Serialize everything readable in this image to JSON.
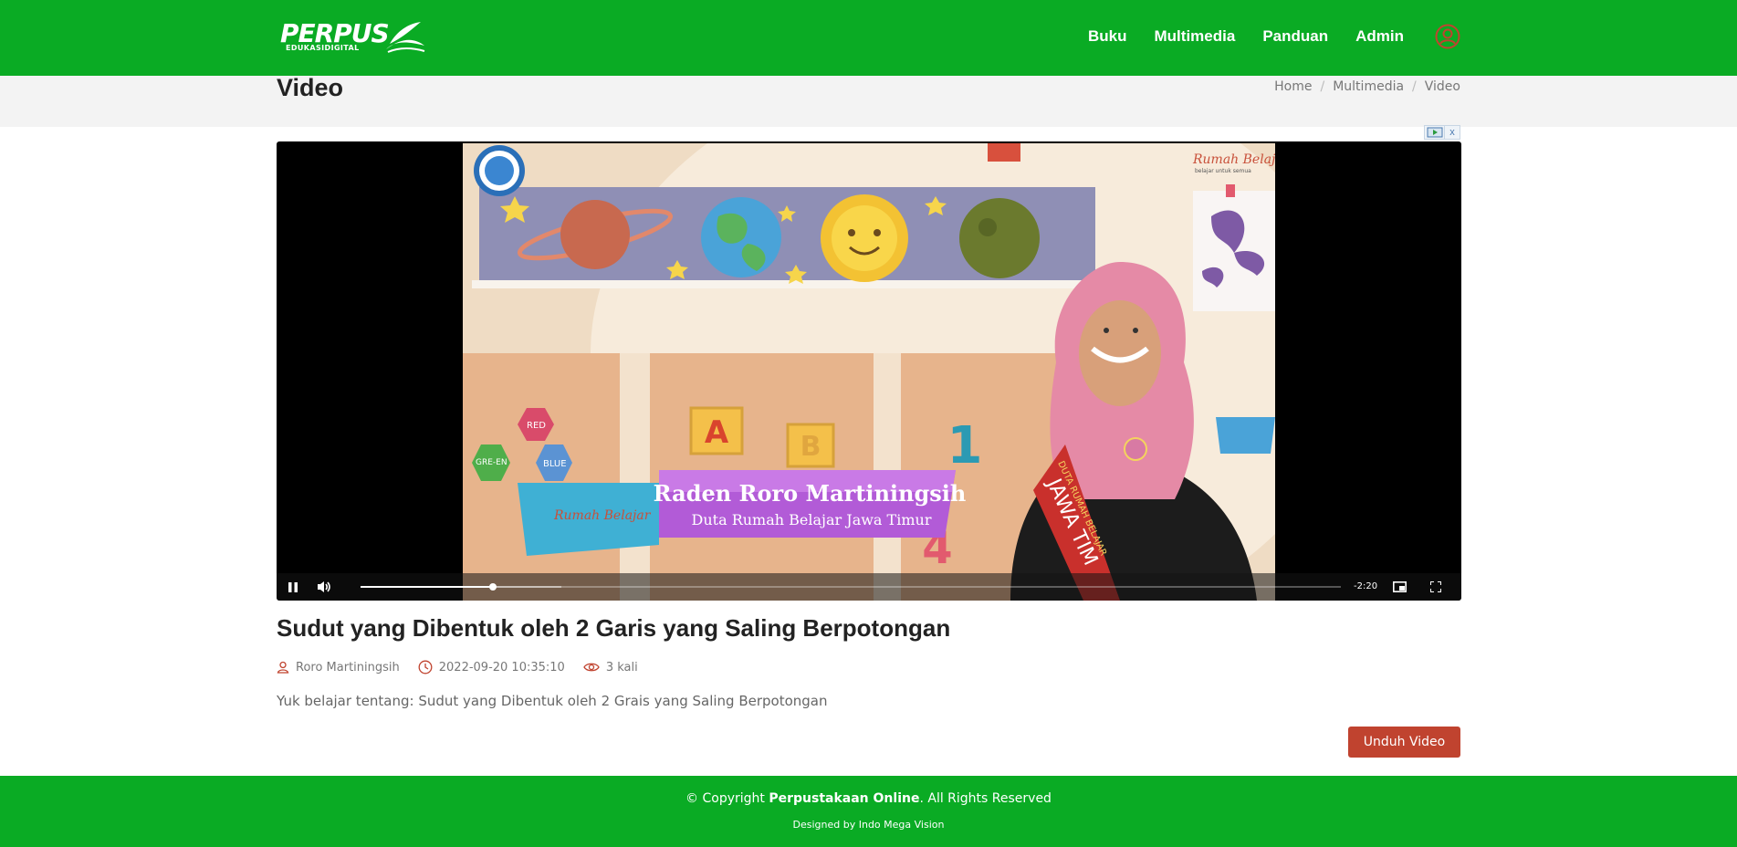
{
  "header": {
    "logo_text": "PERPUS",
    "logo_subtext": "EDUKASIDIGITAL",
    "nav": [
      "Buku",
      "Multimedia",
      "Panduan",
      "Admin"
    ],
    "user_icon": "user-circle-icon"
  },
  "titlebar": {
    "title": "Video",
    "breadcrumb": [
      "Home",
      "Multimedia",
      "Video"
    ]
  },
  "player": {
    "overlay_name": "Raden Roro Martiningsih",
    "overlay_role": "Duta Rumah Belajar Jawa Timur",
    "brand": "Rumah Belajar",
    "brand_tagline": "belajar untuk semua",
    "sash_text": "DUTA RUMAH BELAJAR",
    "sash_big": "JAWA TIM",
    "shape_labels": [
      "RED",
      "GRE-EN",
      "BLUE"
    ],
    "letters": [
      "A",
      "B",
      "1",
      "4"
    ],
    "time_remaining": "-2:20",
    "progress_played": 0.135,
    "progress_buffered": 0.205,
    "state": "playing"
  },
  "video": {
    "title": "Sudut yang Dibentuk oleh 2 Garis yang Saling Berpotongan",
    "author": "Roro Martiningsih",
    "datetime": "2022-09-20 10:35:10",
    "views": "3 kali",
    "description": "Yuk belajar tentang: Sudut yang Dibentuk oleh 2 Grais yang Saling Berpotongan",
    "download_label": "Unduh Video"
  },
  "footer": {
    "copyright_prefix": "© Copyright",
    "site_name": "Perpustakaan Online",
    "copyright_suffix": ". All Rights Reserved",
    "designed": "Designed by Indo Mega Vision"
  },
  "colors": {
    "brand_green": "#0aab24",
    "accent_red": "#c0432f",
    "titlebar_bg": "#f3f3f3"
  }
}
